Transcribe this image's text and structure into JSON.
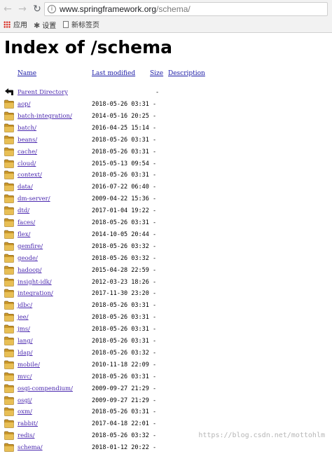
{
  "browser": {
    "url_host": "www.springframework.org",
    "url_path": "/schema/",
    "bookmarks": [
      {
        "label": "应用",
        "icon": "apps-grid-icon"
      },
      {
        "label": "设置",
        "icon": "gear-icon"
      },
      {
        "label": "新标签页",
        "icon": "page-icon"
      }
    ]
  },
  "page": {
    "title": "Index of /schema",
    "columns": {
      "name": "Name",
      "last_modified": "Last modified",
      "size": "Size",
      "description": "Description"
    },
    "parent": {
      "name": "Parent Directory",
      "size": "-",
      "icon": "back-arrow-icon"
    },
    "entries": [
      {
        "name": "aop/",
        "modified": "2018-05-26 03:31",
        "size": "-"
      },
      {
        "name": "batch-integration/",
        "modified": "2014-05-16 20:25",
        "size": "-"
      },
      {
        "name": "batch/",
        "modified": "2016-04-25 15:14",
        "size": "-"
      },
      {
        "name": "beans/",
        "modified": "2018-05-26 03:31",
        "size": "-"
      },
      {
        "name": "cache/",
        "modified": "2018-05-26 03:31",
        "size": "-"
      },
      {
        "name": "cloud/",
        "modified": "2015-05-13 09:54",
        "size": "-"
      },
      {
        "name": "context/",
        "modified": "2018-05-26 03:31",
        "size": "-"
      },
      {
        "name": "data/",
        "modified": "2016-07-22 06:40",
        "size": "-"
      },
      {
        "name": "dm-server/",
        "modified": "2009-04-22 15:36",
        "size": "-"
      },
      {
        "name": "dtd/",
        "modified": "2017-01-04 19:22",
        "size": "-"
      },
      {
        "name": "faces/",
        "modified": "2018-05-26 03:31",
        "size": "-"
      },
      {
        "name": "flex/",
        "modified": "2014-10-05 20:44",
        "size": "-"
      },
      {
        "name": "gemfire/",
        "modified": "2018-05-26 03:32",
        "size": "-"
      },
      {
        "name": "geode/",
        "modified": "2018-05-26 03:32",
        "size": "-"
      },
      {
        "name": "hadoop/",
        "modified": "2015-04-28 22:59",
        "size": "-"
      },
      {
        "name": "insight-idk/",
        "modified": "2012-03-23 18:26",
        "size": "-"
      },
      {
        "name": "integration/",
        "modified": "2017-11-30 23:20",
        "size": "-"
      },
      {
        "name": "jdbc/",
        "modified": "2018-05-26 03:31",
        "size": "-"
      },
      {
        "name": "jee/",
        "modified": "2018-05-26 03:31",
        "size": "-"
      },
      {
        "name": "jms/",
        "modified": "2018-05-26 03:31",
        "size": "-"
      },
      {
        "name": "lang/",
        "modified": "2018-05-26 03:31",
        "size": "-"
      },
      {
        "name": "ldap/",
        "modified": "2018-05-26 03:32",
        "size": "-"
      },
      {
        "name": "mobile/",
        "modified": "2010-11-18 22:09",
        "size": "-"
      },
      {
        "name": "mvc/",
        "modified": "2018-05-26 03:31",
        "size": "-"
      },
      {
        "name": "osgi-compendium/",
        "modified": "2009-09-27 21:29",
        "size": "-"
      },
      {
        "name": "osgi/",
        "modified": "2009-09-27 21:29",
        "size": "-"
      },
      {
        "name": "oxm/",
        "modified": "2018-05-26 03:31",
        "size": "-"
      },
      {
        "name": "rabbit/",
        "modified": "2017-04-18 22:01",
        "size": "-"
      },
      {
        "name": "redis/",
        "modified": "2018-05-26 03:32",
        "size": "-"
      },
      {
        "name": "schema/",
        "modified": "2018-01-12 20:22",
        "size": "-"
      }
    ],
    "folder_icon": "folder-icon"
  },
  "watermark": "https://blog.csdn.net/mottohlm"
}
